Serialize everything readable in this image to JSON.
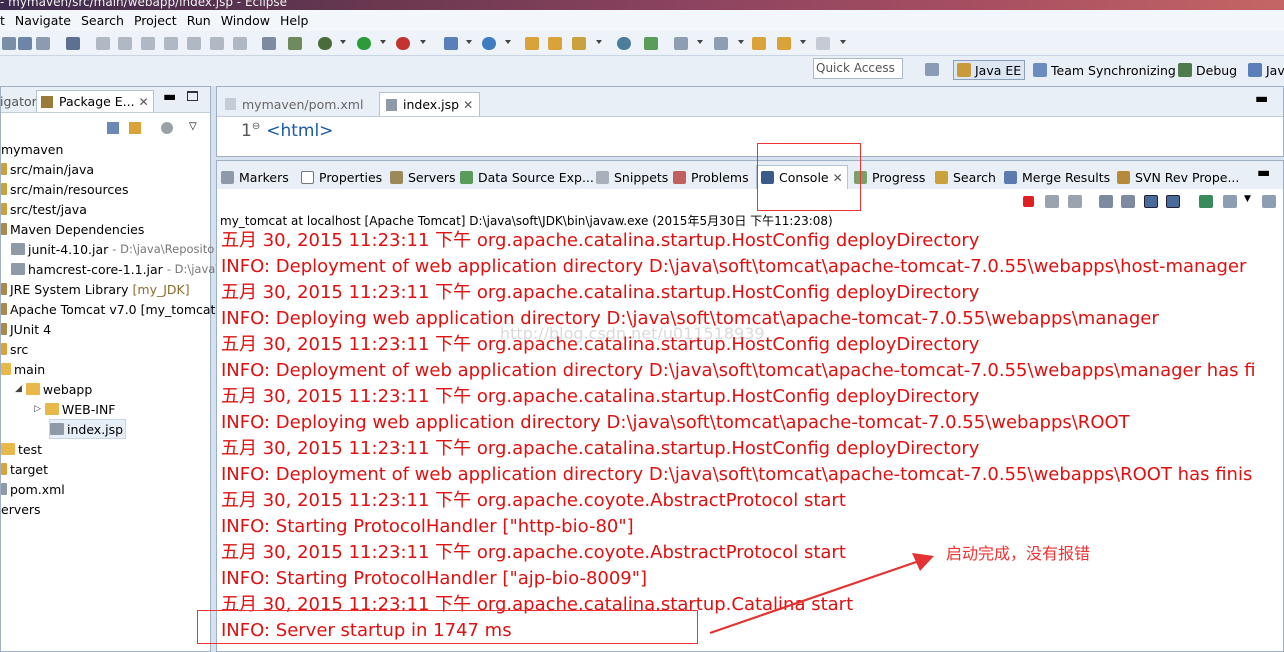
{
  "window": {
    "title": "- mymaven/src/main/webapp/index.jsp - Eclipse"
  },
  "menu": [
    "t",
    "Navigate",
    "Search",
    "Project",
    "Run",
    "Window",
    "Help"
  ],
  "quick_access": {
    "placeholder": "Quick Access"
  },
  "perspectives": [
    "Java EE",
    "Team Synchronizing",
    "Debug",
    "Jav"
  ],
  "left_panel": {
    "tabs": [
      "igator",
      "Package E..."
    ],
    "tree": [
      {
        "label": "mymaven"
      },
      {
        "label": "src/main/java"
      },
      {
        "label": "src/main/resources"
      },
      {
        "label": "src/test/java"
      },
      {
        "label": "Maven Dependencies"
      },
      {
        "label": "junit-4.10.jar",
        "path": "- D:\\java\\Reposito"
      },
      {
        "label": "hamcrest-core-1.1.jar",
        "path": "- D:\\java\\"
      },
      {
        "label": "JRE System Library",
        "extra": "[my_JDK]"
      },
      {
        "label": "Apache Tomcat v7.0 [my_tomcat]"
      },
      {
        "label": "JUnit 4"
      },
      {
        "label": "src"
      },
      {
        "label": "main"
      },
      {
        "label": "webapp"
      },
      {
        "label": "WEB-INF"
      },
      {
        "label": "index.jsp"
      },
      {
        "label": "test"
      },
      {
        "label": "target"
      },
      {
        "label": "pom.xml"
      },
      {
        "label": "ervers"
      }
    ]
  },
  "editor": {
    "tabs": [
      "mymaven/pom.xml",
      "index.jsp"
    ],
    "line_number": "1",
    "code": "<html>"
  },
  "console": {
    "tabs": [
      "Markers",
      "Properties",
      "Servers",
      "Data Source Exp...",
      "Snippets",
      "Problems",
      "Console",
      "Progress",
      "Search",
      "Merge Results",
      "SVN Rev Prope..."
    ],
    "description": "my_tomcat at localhost [Apache Tomcat] D:\\java\\soft\\JDK\\bin\\javaw.exe (2015年5月30日 下午11:23:08)",
    "lines": [
      "五月 30, 2015 11:23:11 下午 org.apache.catalina.startup.HostConfig deployDirectory",
      "INFO: Deployment of web application directory D:\\java\\soft\\tomcat\\apache-tomcat-7.0.55\\webapps\\host-manager",
      "五月 30, 2015 11:23:11 下午 org.apache.catalina.startup.HostConfig deployDirectory",
      "INFO: Deploying web application directory D:\\java\\soft\\tomcat\\apache-tomcat-7.0.55\\webapps\\manager",
      "五月 30, 2015 11:23:11 下午 org.apache.catalina.startup.HostConfig deployDirectory",
      "INFO: Deployment of web application directory D:\\java\\soft\\tomcat\\apache-tomcat-7.0.55\\webapps\\manager has fi",
      "五月 30, 2015 11:23:11 下午 org.apache.catalina.startup.HostConfig deployDirectory",
      "INFO: Deploying web application directory D:\\java\\soft\\tomcat\\apache-tomcat-7.0.55\\webapps\\ROOT",
      "五月 30, 2015 11:23:11 下午 org.apache.catalina.startup.HostConfig deployDirectory",
      "INFO: Deployment of web application directory D:\\java\\soft\\tomcat\\apache-tomcat-7.0.55\\webapps\\ROOT has finis",
      "五月 30, 2015 11:23:11 下午 org.apache.coyote.AbstractProtocol start",
      "INFO: Starting ProtocolHandler [\"http-bio-80\"]",
      "五月 30, 2015 11:23:11 下午 org.apache.coyote.AbstractProtocol start",
      "INFO: Starting ProtocolHandler [\"ajp-bio-8009\"]",
      "五月 30, 2015 11:23:11 下午 org.apache.catalina.startup.Catalina start",
      "INFO: Server startup in 1747 ms"
    ],
    "log_color": "#e01010"
  },
  "watermark": "http://blog.csdn.net/u011518939",
  "annotation": {
    "text": "启动完成，没有报错",
    "color": "#e33333"
  }
}
